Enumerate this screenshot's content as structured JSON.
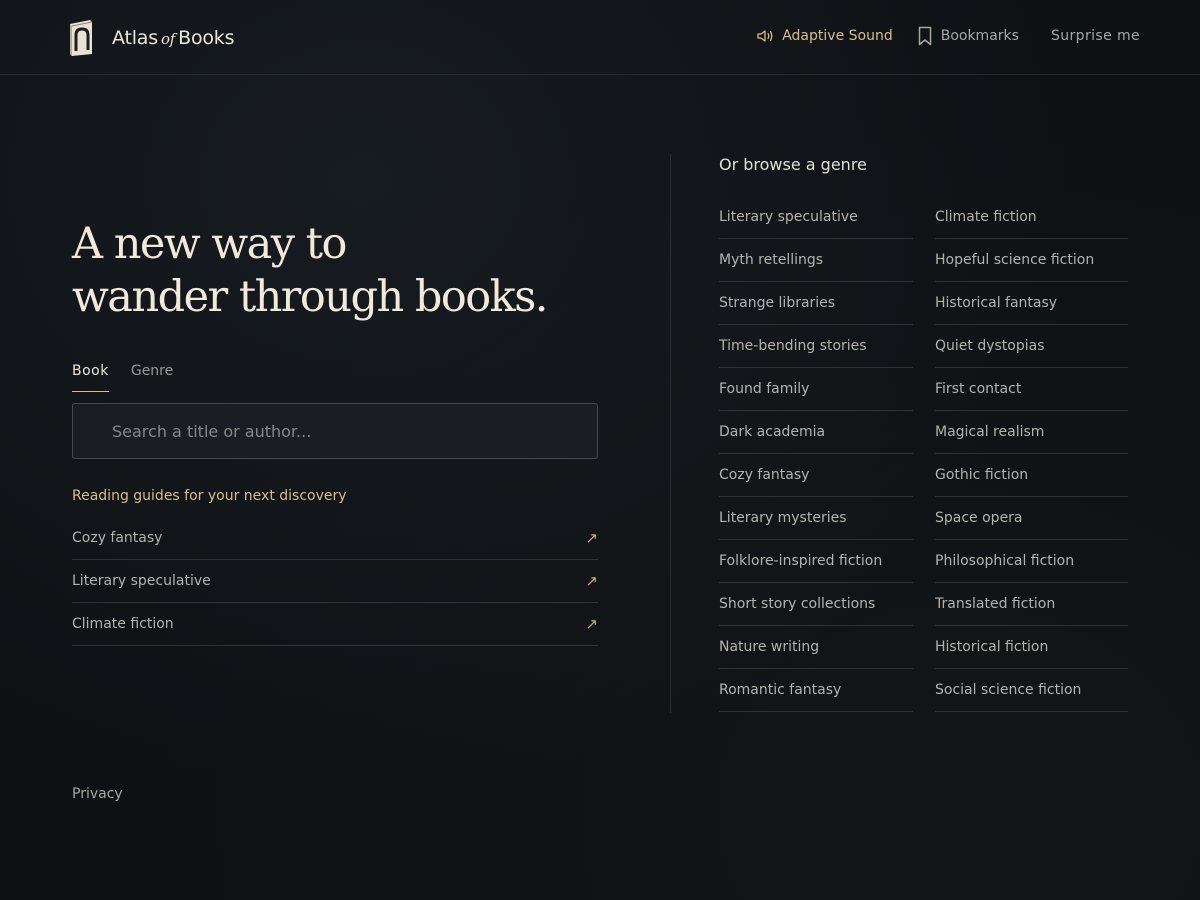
{
  "header": {
    "brand_main": "Atlas",
    "brand_of": "of",
    "brand_end": "Books",
    "nav": {
      "sound_label": "Adaptive Sound",
      "bookmarks_label": "Bookmarks",
      "surprise_label": "Surprise me"
    }
  },
  "hero": {
    "title_line1": "A new way to",
    "title_line2": "wander through books."
  },
  "tabs": [
    "Book",
    "Genre"
  ],
  "search": {
    "placeholder": "Search a title or author..."
  },
  "guides": {
    "title": "Reading guides for your next discovery",
    "items": [
      "Cozy fantasy",
      "Literary speculative",
      "Climate fiction"
    ]
  },
  "browse": {
    "title": "Or browse a genre",
    "left": [
      "Literary speculative",
      "Myth retellings",
      "Strange libraries",
      "Time-bending stories",
      "Found family",
      "Dark academia",
      "Cozy fantasy",
      "Literary mysteries",
      "Folklore-inspired fiction",
      "Short story collections",
      "Nature writing",
      "Romantic fantasy"
    ],
    "right": [
      "Climate fiction",
      "Hopeful science fiction",
      "Historical fantasy",
      "Quiet dystopias",
      "First contact",
      "Magical realism",
      "Gothic fiction",
      "Space opera",
      "Philosophical fiction",
      "Translated fiction",
      "Historical fiction",
      "Social science fiction"
    ]
  },
  "footer": {
    "privacy": "Privacy"
  },
  "colors": {
    "background": "#0e1114",
    "accent": "#d9bd8a",
    "title": "#f1ead9"
  },
  "icons": {
    "logo": "book-icon",
    "sound": "speaker-icon",
    "bookmark": "bookmark-icon",
    "guide_link": "arrow-up-right-icon"
  }
}
